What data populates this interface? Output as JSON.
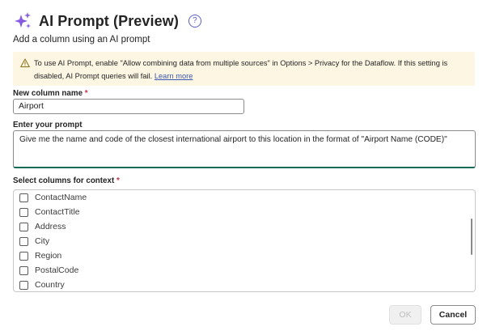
{
  "dialog": {
    "title": "AI Prompt (Preview)",
    "help_icon": "question-circle-icon",
    "subtitle": "Add a column using an AI prompt"
  },
  "warning": {
    "icon": "warning-triangle-icon",
    "text": "To use AI Prompt, enable \"Allow combining data from multiple sources\" in Options > Privacy for the Dataflow. If this setting is disabled, AI Prompt queries will fail.",
    "link": "Learn more",
    "background": "#fdf6e3"
  },
  "column_name": {
    "label": "New column name",
    "required_mark": "*",
    "value": "Airport"
  },
  "prompt": {
    "label": "Enter your prompt",
    "value": "Give me the name and code of the closest international airport to this location in the format of \"Airport Name (CODE)\""
  },
  "context": {
    "label": "Select columns for context",
    "required_mark": "*",
    "items": [
      {
        "label": "ContactName",
        "checked": false
      },
      {
        "label": "ContactTitle",
        "checked": false
      },
      {
        "label": "Address",
        "checked": false
      },
      {
        "label": "City",
        "checked": false
      },
      {
        "label": "Region",
        "checked": false
      },
      {
        "label": "PostalCode",
        "checked": false
      },
      {
        "label": "Country",
        "checked": false
      }
    ]
  },
  "buttons": {
    "ok": "OK",
    "cancel": "Cancel"
  },
  "colors": {
    "accent": "#0f6b56",
    "link": "#3a56b0",
    "required": "#c4314b"
  }
}
